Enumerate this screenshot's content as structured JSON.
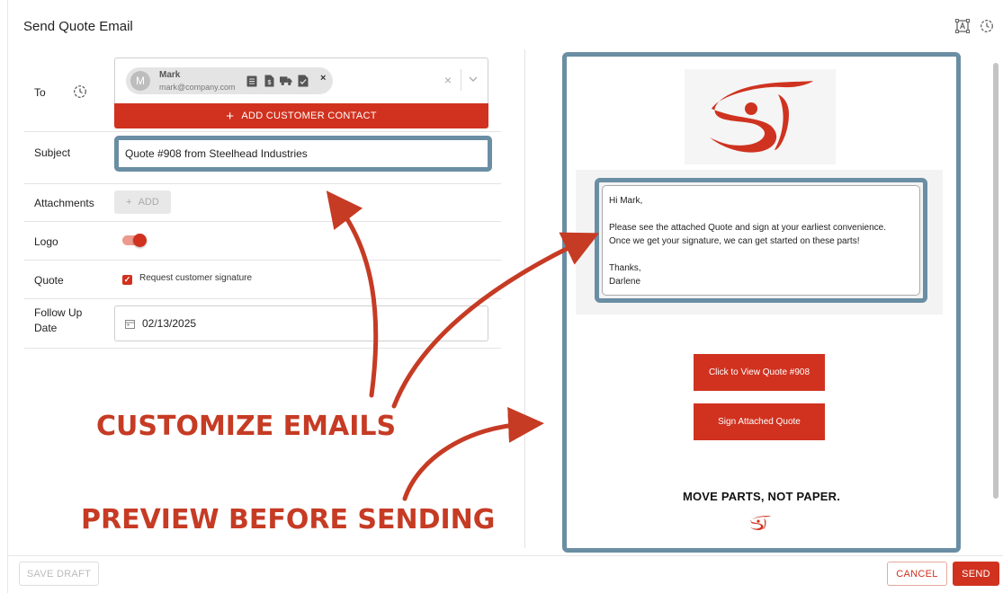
{
  "dialog": {
    "title": "Send Quote Email",
    "top_icons": [
      "text-recognition-icon",
      "history-clock-icon"
    ]
  },
  "form": {
    "to": {
      "label": "To",
      "contact": {
        "initial": "M",
        "name": "Mark",
        "email": "mark@company.com"
      },
      "chip_icons": [
        "document-icon",
        "invoice-icon",
        "truck-icon",
        "signed-document-icon"
      ],
      "chip_remove": "×",
      "clear": "×",
      "add_contact_label": "ADD CUSTOMER CONTACT",
      "add_contact_icon": "+"
    },
    "subject": {
      "label": "Subject",
      "value": "Quote #908 from Steelhead Industries"
    },
    "attachments": {
      "label": "Attachments",
      "add_label": "ADD",
      "add_icon": "+"
    },
    "logo": {
      "label": "Logo",
      "enabled": true
    },
    "quote": {
      "label": "Quote",
      "checkbox_label": "Request customer signature",
      "checked": true
    },
    "follow_up": {
      "label": "Follow Up Date",
      "value": "02/13/2025"
    }
  },
  "preview": {
    "greeting": "Hi Mark,",
    "body_line1": "Please see the attached Quote and sign at your earliest convenience.",
    "body_line2": "Once we get your signature, we can get started on these parts!",
    "signoff": "Thanks,",
    "signature": "Darlene",
    "cta_view": "Click to View Quote #908",
    "cta_sign": "Sign Attached Quote",
    "tagline": "MOVE PARTS, NOT PAPER."
  },
  "callouts": {
    "customize": "CUSTOMIZE EMAILS",
    "preview": "PREVIEW BEFORE SENDING"
  },
  "footer": {
    "save_draft": "SAVE DRAFT",
    "cancel": "CANCEL",
    "send": "SEND"
  },
  "colors": {
    "accent": "#d0321f",
    "highlight_frame": "#6a8ea3",
    "callout": "#c63b24"
  }
}
